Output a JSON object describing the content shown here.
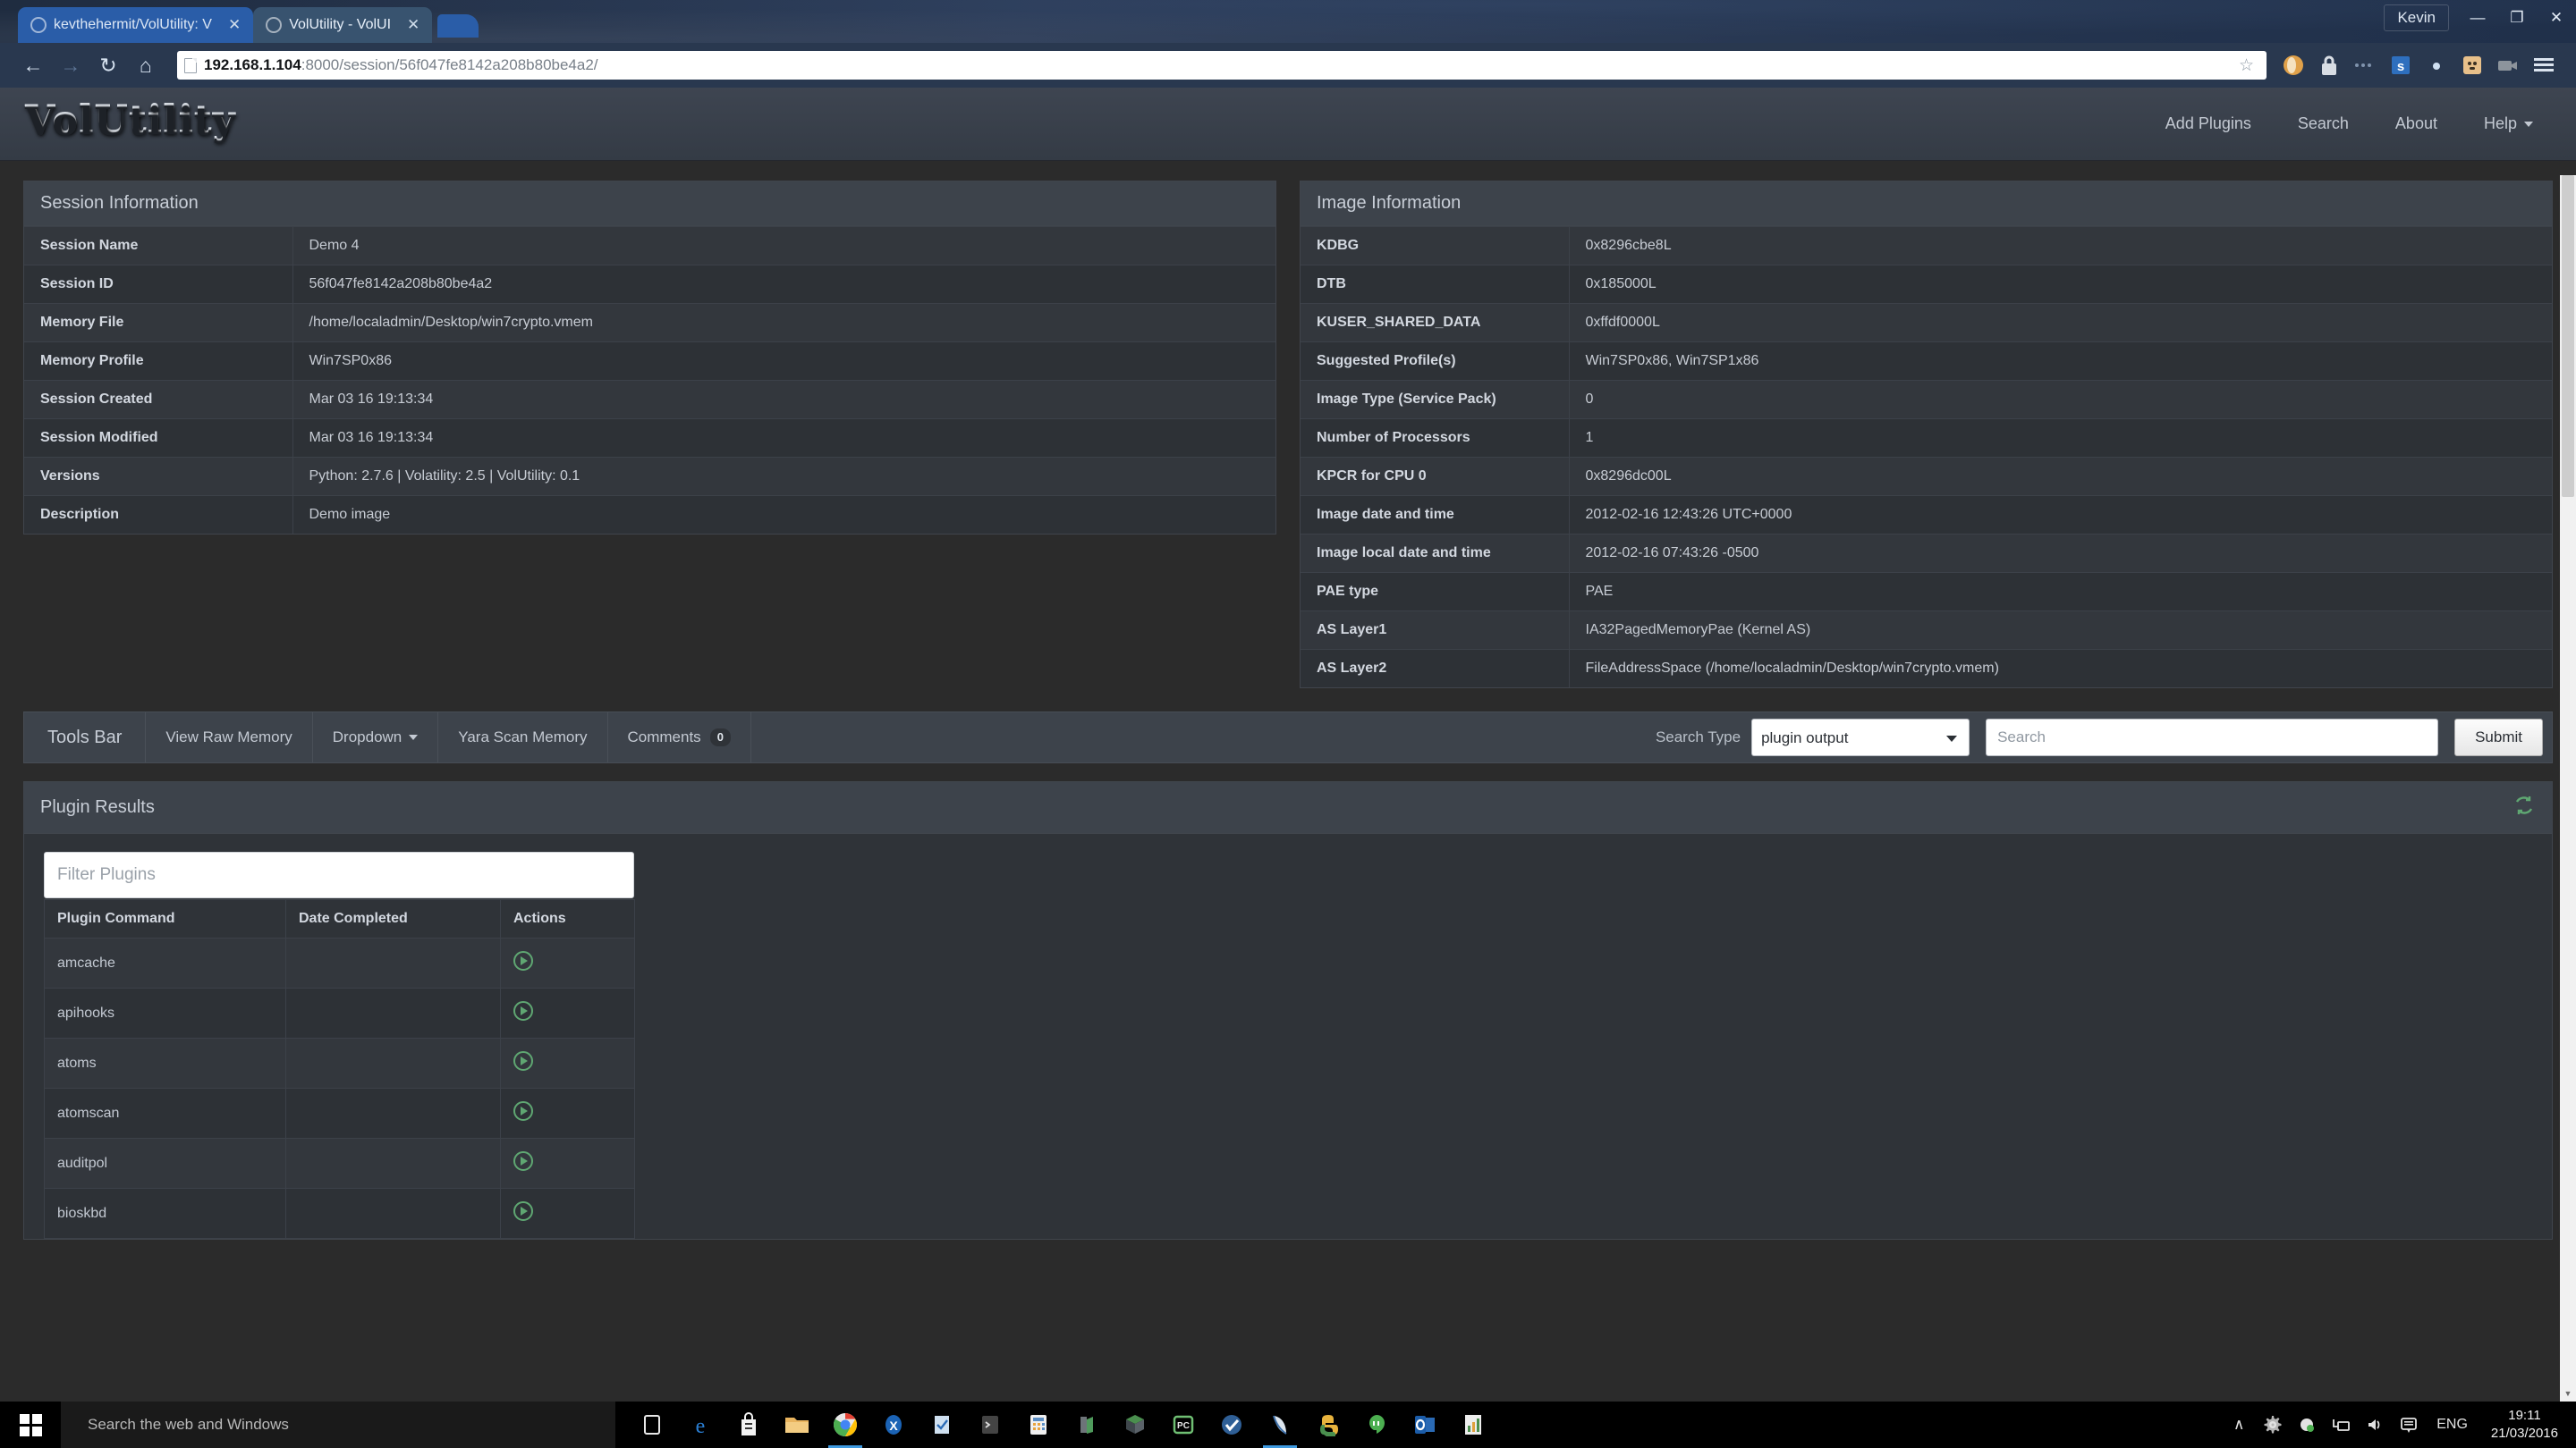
{
  "browser": {
    "tabs": [
      {
        "title": "kevthehermit/VolUtility: V",
        "active": false
      },
      {
        "title": "VolUtility - VolUI",
        "active": true
      }
    ],
    "window_user": "Kevin",
    "minimize": "—",
    "maximize": "❐",
    "close": "✕",
    "nav": {
      "back": "←",
      "forward": "→",
      "reload": "↻",
      "home": "⌂"
    },
    "url_host": "192.168.1.104",
    "url_rest": ":8000/session/56f047fe8142a208b80be4a2/",
    "bookmark_star": "☆"
  },
  "navbar": {
    "brand": "VolUtility",
    "links": [
      {
        "label": "Add Plugins",
        "caret": false
      },
      {
        "label": "Search",
        "caret": false
      },
      {
        "label": "About",
        "caret": false
      },
      {
        "label": "Help",
        "caret": true
      }
    ]
  },
  "session_panel": {
    "title": "Session Information",
    "rows": [
      {
        "key": "Session Name",
        "value": "Demo 4"
      },
      {
        "key": "Session ID",
        "value": "56f047fe8142a208b80be4a2"
      },
      {
        "key": "Memory File",
        "value": "/home/localadmin/Desktop/win7crypto.vmem"
      },
      {
        "key": "Memory Profile",
        "value": "Win7SP0x86"
      },
      {
        "key": "Session Created",
        "value": "Mar 03 16 19:13:34"
      },
      {
        "key": "Session Modified",
        "value": "Mar 03 16 19:13:34"
      },
      {
        "key": "Versions",
        "value": "Python: 2.7.6 | Volatility: 2.5 | VolUtility: 0.1"
      },
      {
        "key": "Description",
        "value": "Demo image"
      }
    ]
  },
  "image_panel": {
    "title": "Image Information",
    "rows": [
      {
        "key": "KDBG",
        "value": "0x8296cbe8L"
      },
      {
        "key": "DTB",
        "value": "0x185000L"
      },
      {
        "key": "KUSER_SHARED_DATA",
        "value": "0xffdf0000L"
      },
      {
        "key": "Suggested Profile(s)",
        "value": "Win7SP0x86, Win7SP1x86"
      },
      {
        "key": "Image Type (Service Pack)",
        "value": "0"
      },
      {
        "key": "Number of Processors",
        "value": "1"
      },
      {
        "key": "KPCR for CPU 0",
        "value": "0x8296dc00L"
      },
      {
        "key": "Image date and time",
        "value": "2012-02-16 12:43:26 UTC+0000"
      },
      {
        "key": "Image local date and time",
        "value": "2012-02-16 07:43:26 -0500"
      },
      {
        "key": "PAE type",
        "value": "PAE"
      },
      {
        "key": "AS Layer1",
        "value": "IA32PagedMemoryPae (Kernel AS)"
      },
      {
        "key": "AS Layer2",
        "value": "FileAddressSpace (/home/localadmin/Desktop/win7crypto.vmem)"
      }
    ]
  },
  "tools_bar": {
    "title": "Tools Bar",
    "buttons": [
      {
        "label": "View Raw Memory",
        "caret": false,
        "badge": null
      },
      {
        "label": "Dropdown",
        "caret": true,
        "badge": null
      },
      {
        "label": "Yara Scan Memory",
        "caret": false,
        "badge": null
      },
      {
        "label": "Comments",
        "caret": false,
        "badge": "0"
      }
    ],
    "search_type_label": "Search Type",
    "search_type_value": "plugin output",
    "search_type_options": [
      "plugin output"
    ],
    "search_placeholder": "Search",
    "search_value": "",
    "submit_label": "Submit"
  },
  "plugin_results": {
    "title": "Plugin Results",
    "refresh_icon": "refresh-icon",
    "filter_placeholder": "Filter Plugins",
    "filter_value": "",
    "columns": [
      "Plugin Command",
      "Date Completed",
      "Actions"
    ],
    "rows": [
      {
        "command": "amcache",
        "date": "",
        "action": "run-plugin-icon"
      },
      {
        "command": "apihooks",
        "date": "",
        "action": "run-plugin-icon"
      },
      {
        "command": "atoms",
        "date": "",
        "action": "run-plugin-icon"
      },
      {
        "command": "atomscan",
        "date": "",
        "action": "run-plugin-icon"
      },
      {
        "command": "auditpol",
        "date": "",
        "action": "run-plugin-icon"
      },
      {
        "command": "bioskbd",
        "date": "",
        "action": "run-plugin-icon"
      }
    ]
  },
  "taskbar": {
    "search_placeholder": "Search the web and Windows",
    "tray": {
      "chevron": "∧",
      "language": "ENG",
      "time": "19:11",
      "date": "21/03/2016"
    }
  },
  "colors": {
    "accent_green": "#5fa772",
    "panel_bg": "#2f3338",
    "panel_head": "#3d434b",
    "page_bg": "#2b2b2b",
    "chrome_blue": "#2a5da8"
  }
}
